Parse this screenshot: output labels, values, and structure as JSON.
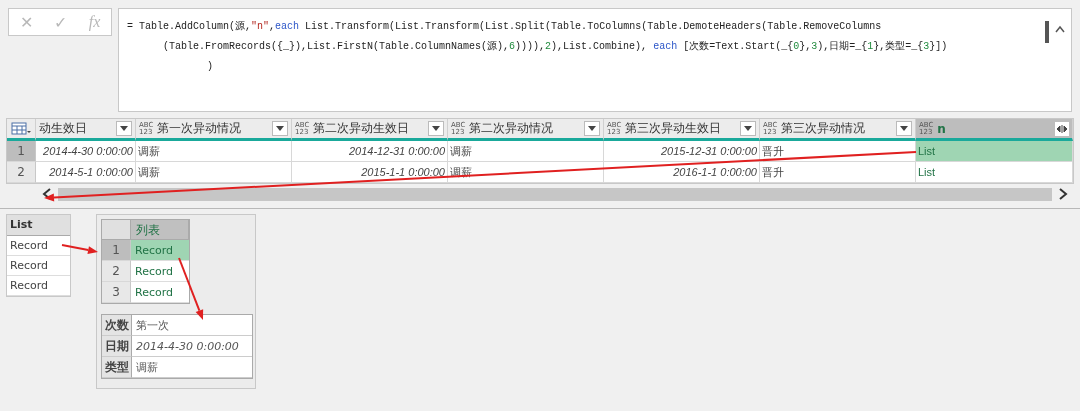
{
  "formula_bar": {
    "cancel": "✕",
    "confirm": "✓",
    "fx": "fx",
    "lines": [
      [
        {
          "text": "= Table.AddColumn(源,",
          "kind": "plain"
        },
        {
          "text": "\"n\"",
          "kind": "string"
        },
        {
          "text": ",",
          "kind": "plain"
        },
        {
          "text": "each",
          "kind": "keyword"
        },
        {
          "text": " List.Transform(List.Transform(List.Split(Table.ToColumns(Table.DemoteHeaders(Table.RemoveColumns",
          "kind": "plain"
        }
      ],
      [
        {
          "text": "(Table.FromRecords({_}),List.FirstN(Table.ColumnNames(源),",
          "kind": "plain"
        },
        {
          "text": "6",
          "kind": "number"
        },
        {
          "text": ")))),",
          "kind": "plain"
        },
        {
          "text": "2",
          "kind": "number"
        },
        {
          "text": "),List.Combine), ",
          "kind": "plain"
        },
        {
          "text": "each",
          "kind": "keyword"
        },
        {
          "text": " [次数=Text.Start(_{",
          "kind": "plain"
        },
        {
          "text": "0",
          "kind": "number"
        },
        {
          "text": "},",
          "kind": "plain"
        },
        {
          "text": "3",
          "kind": "number"
        },
        {
          "text": "),日期=_{",
          "kind": "plain"
        },
        {
          "text": "1",
          "kind": "number"
        },
        {
          "text": "},类型=_{",
          "kind": "plain"
        },
        {
          "text": "3",
          "kind": "number"
        },
        {
          "text": "}])",
          "kind": "plain"
        }
      ],
      [
        {
          "text": ")",
          "kind": "plain"
        }
      ]
    ]
  },
  "table": {
    "columns": [
      {
        "label": "动生效日",
        "kind": "date"
      },
      {
        "label": "第一次异动情况",
        "type": [
          "ABC",
          "123"
        ],
        "kind": "text"
      },
      {
        "label": "第二次异动生效日",
        "type": [
          "ABC",
          "123"
        ],
        "kind": "date"
      },
      {
        "label": "第二次异动情况",
        "type": [
          "ABC",
          "123"
        ],
        "kind": "text"
      },
      {
        "label": "第三次异动生效日",
        "type": [
          "ABC",
          "123"
        ],
        "kind": "date"
      },
      {
        "label": "第三次异动情况",
        "type": [
          "ABC",
          "123"
        ],
        "kind": "text"
      },
      {
        "label": "n",
        "type": [
          "ABC",
          "123"
        ],
        "kind": "list",
        "selected": true
      }
    ],
    "rows": [
      {
        "number": "1",
        "selected": true,
        "cells": [
          "2014-4-30 0:00:00",
          "调薪",
          "2014-12-31 0:00:00",
          "调薪",
          "2015-12-31 0:00:00",
          "晋升",
          "List"
        ]
      },
      {
        "number": "2",
        "selected": false,
        "cells": [
          "2014-5-1 0:00:00",
          "调薪",
          "2015-1-1 0:00:00",
          "调薪",
          "2016-1-1 0:00:00",
          "晋升",
          "List"
        ]
      }
    ]
  },
  "list_preview": {
    "header": "List",
    "items": [
      "Record",
      "Record",
      "Record"
    ]
  },
  "list_table": {
    "header": "列表",
    "rows": [
      {
        "number": "1",
        "value": "Record",
        "selected": true
      },
      {
        "number": "2",
        "value": "Record",
        "selected": false
      },
      {
        "number": "3",
        "value": "Record",
        "selected": false
      }
    ]
  },
  "record": [
    {
      "field": "次数",
      "value": "第一次",
      "kind": "text"
    },
    {
      "field": "日期",
      "value": "2014-4-30 0:00:00",
      "kind": "date"
    },
    {
      "field": "类型",
      "value": "调薪",
      "kind": "text"
    }
  ]
}
